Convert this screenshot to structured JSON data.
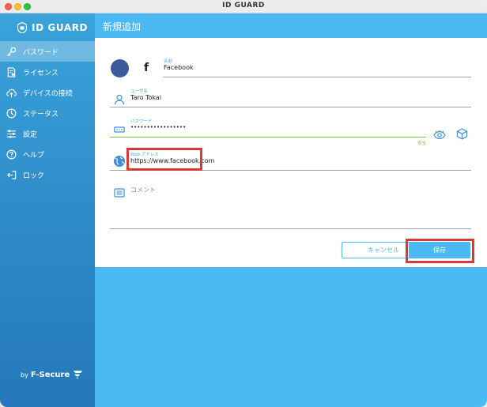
{
  "window": {
    "title": "ID GUARD"
  },
  "sidebar": {
    "logo_text": "ID GUARD",
    "items": [
      {
        "label": "パスワード",
        "icon": "key-icon",
        "active": true
      },
      {
        "label": "ライセンス",
        "icon": "license-icon",
        "active": false
      },
      {
        "label": "デバイスの接続",
        "icon": "cloud-upload-icon",
        "active": false
      },
      {
        "label": "ステータス",
        "icon": "status-icon",
        "active": false
      },
      {
        "label": "設定",
        "icon": "sliders-icon",
        "active": false
      },
      {
        "label": "ヘルプ",
        "icon": "help-icon",
        "active": false
      },
      {
        "label": "ロック",
        "icon": "lock-exit-icon",
        "active": false
      }
    ],
    "footer_by": "by",
    "footer_brand": "F-Secure"
  },
  "header": {
    "title": "新規追加"
  },
  "form": {
    "name": {
      "label": "名前",
      "value": "Facebook",
      "icon": "facebook-icon"
    },
    "username": {
      "label": "ユーザ名",
      "value": "Taro Tokai",
      "icon": "user-icon"
    },
    "password": {
      "label": "パスワード",
      "value": "•••••••••••••••••",
      "strength": "安全",
      "icon": "password-icon"
    },
    "web": {
      "label": "Web アドレス",
      "value": "https://www.facebook.com",
      "icon": "globe-icon"
    },
    "comment": {
      "placeholder": "コメント",
      "icon": "comment-icon"
    }
  },
  "actions": {
    "cancel_label": "キャンセル",
    "save_label": "保存"
  },
  "colors": {
    "accent": "#4bbaf4",
    "highlight": "#d93a35",
    "facebook": "#3b5a99",
    "strength": "#7abf3a"
  }
}
